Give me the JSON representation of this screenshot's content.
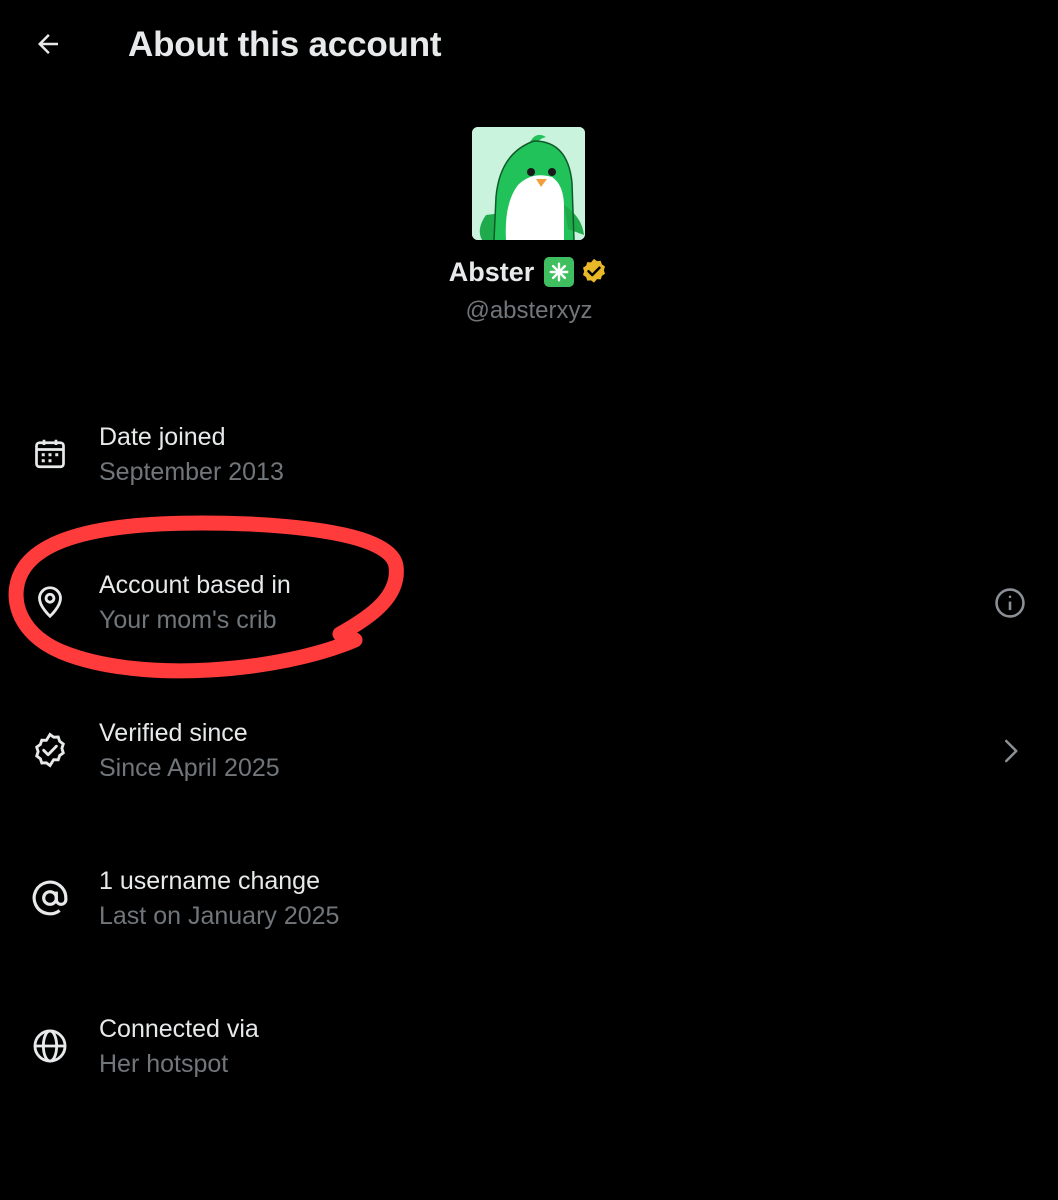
{
  "header": {
    "title": "About this account",
    "back_icon": "arrow-left-icon"
  },
  "profile": {
    "display_name": "Abster",
    "handle": "@absterxyz",
    "name_emoji": "sparkle-emoji",
    "badge": "verified-badge-gold"
  },
  "rows": [
    {
      "title": "Date joined",
      "value": "September 2013",
      "icon": "calendar-icon"
    },
    {
      "title": "Account based in",
      "value": "Your mom's crib",
      "icon": "location-pin-icon",
      "trailing": "info-icon"
    },
    {
      "title": "Verified since",
      "value": "Since April 2025",
      "icon": "verified-check-icon",
      "trailing": "chevron-right-icon"
    },
    {
      "title": "1 username change",
      "value": "Last on January 2025",
      "icon": "at-sign-icon"
    },
    {
      "title": "Connected via",
      "value": "Her hotspot",
      "icon": "globe-icon"
    }
  ],
  "colors": {
    "background": "#000000",
    "primary_text": "#e7e9ea",
    "secondary_text": "#71767b",
    "annotation_red": "#ff3b3b",
    "avatar_green": "#22c25a",
    "badge_gold": "#e8b829"
  }
}
